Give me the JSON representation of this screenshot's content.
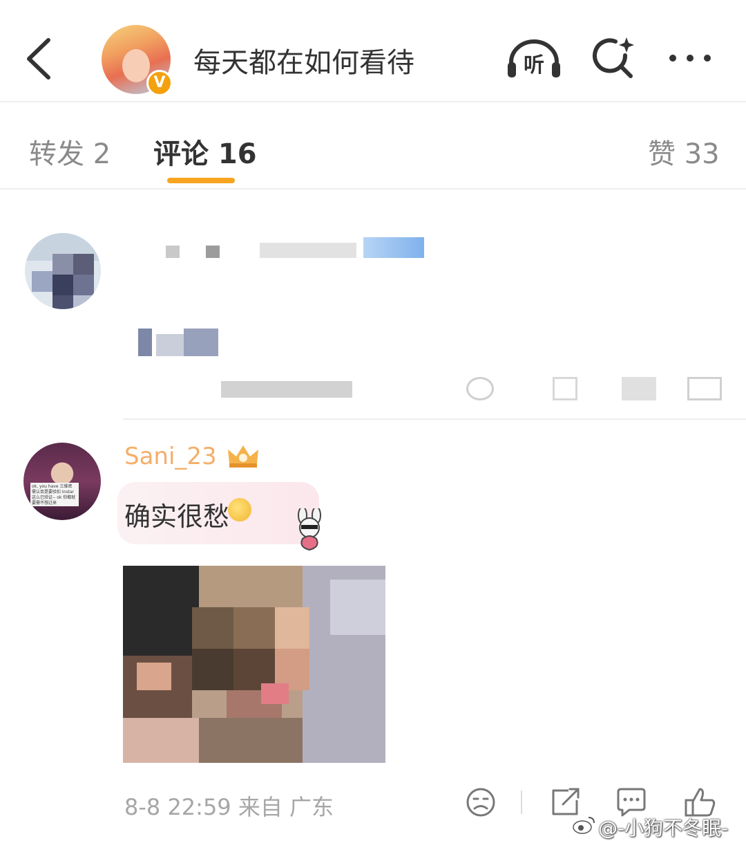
{
  "header": {
    "title": "每天都在如何看待",
    "verified_badge": "V",
    "listen_label": "听"
  },
  "tabs": [
    {
      "label": "转发 2"
    },
    {
      "label": "评论 16"
    },
    {
      "label": "赞 33"
    }
  ],
  "comments": [
    {
      "username": "",
      "text": "",
      "meta": "",
      "redacted": true
    },
    {
      "username": "Sani_23",
      "text": "确实很愁",
      "meta": "8-8 22:59 来自 广东",
      "avatar_card_text": "ok, you have 三维密 需认否是要验扣 Instar这么已验证-- ok 你都就要需不想过来",
      "has_image": true
    }
  ],
  "watermark": "@-小狗不冬眠-",
  "colors": {
    "accent": "#f7a521",
    "username": "#f29a45",
    "verified": "#f4a10f",
    "text": "#333333",
    "muted": "#a6a6a6"
  },
  "icons": [
    "back-icon",
    "listen-icon",
    "search-sparkle-icon",
    "more-icon",
    "dislike-icon",
    "share-icon",
    "comment-icon",
    "like-icon",
    "weibo-logo-icon"
  ]
}
